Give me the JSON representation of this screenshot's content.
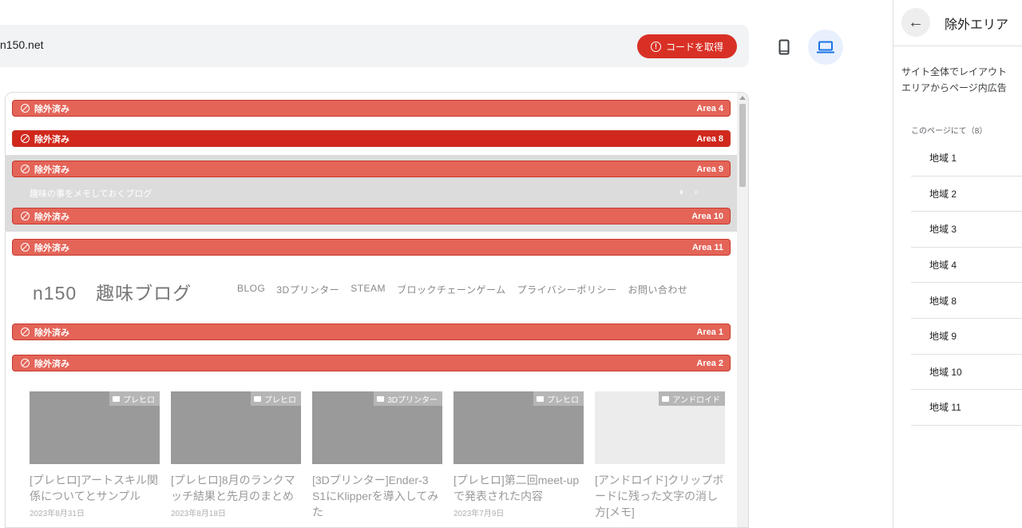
{
  "header": {
    "url": "n150.net",
    "get_code_label": "コードを取得",
    "get_code_icon": "warning-circle-icon",
    "mobile_icon": "smartphone-icon",
    "desktop_icon": "laptop-icon"
  },
  "preview": {
    "excluded_label": "除外済み",
    "areas": [
      "Area 4",
      "Area 8",
      "Area 9",
      "Area 10",
      "Area 11",
      "Area 1",
      "Area 2"
    ],
    "tagline": "趣味の事をメモしておくブログ",
    "tag_icons": [
      "rss-icon",
      "search-icon"
    ],
    "site_logo": "n150　趣味ブログ",
    "nav": [
      "BLOG",
      "3Dプリンター",
      "STEAM",
      "ブロックチェーンゲーム",
      "プライバシーポリシー",
      "お問い合わせ"
    ],
    "cards": [
      {
        "category": "プレヒロ",
        "title": "[プレヒロ]アートスキル関係についてとサンプル",
        "date": "2023年8月31日"
      },
      {
        "category": "プレヒロ",
        "title": "[プレヒロ]8月のランクマッチ結果と先月のまとめ",
        "date": "2023年8月18日"
      },
      {
        "category": "3Dプリンター",
        "title": "[3Dプリンター]Ender-3 S1にKlipperを導入してみた",
        "date": ""
      },
      {
        "category": "プレヒロ",
        "title": "[プレヒロ]第二回meet-upで発表された内容",
        "date": "2023年7月9日"
      },
      {
        "category": "アンドロイド",
        "title": "[アンドロイド]クリップボードに残った文字の消し方[メモ]",
        "date": ""
      }
    ]
  },
  "panel": {
    "title": "除外エリア",
    "description_line1": "サイト全体でレイアウト",
    "description_line2": "エリアからページ内広告",
    "count_label": "このページにて（8）",
    "items": [
      "地域 1",
      "地域 2",
      "地域 3",
      "地域 4",
      "地域 8",
      "地域 9",
      "地域 10",
      "地域 11"
    ]
  },
  "colors": {
    "excluded_bar": "#e46458",
    "excluded_bar_active": "#d0281c",
    "get_code_button": "#d93025",
    "selected_device_bg": "#e8f0fe"
  }
}
